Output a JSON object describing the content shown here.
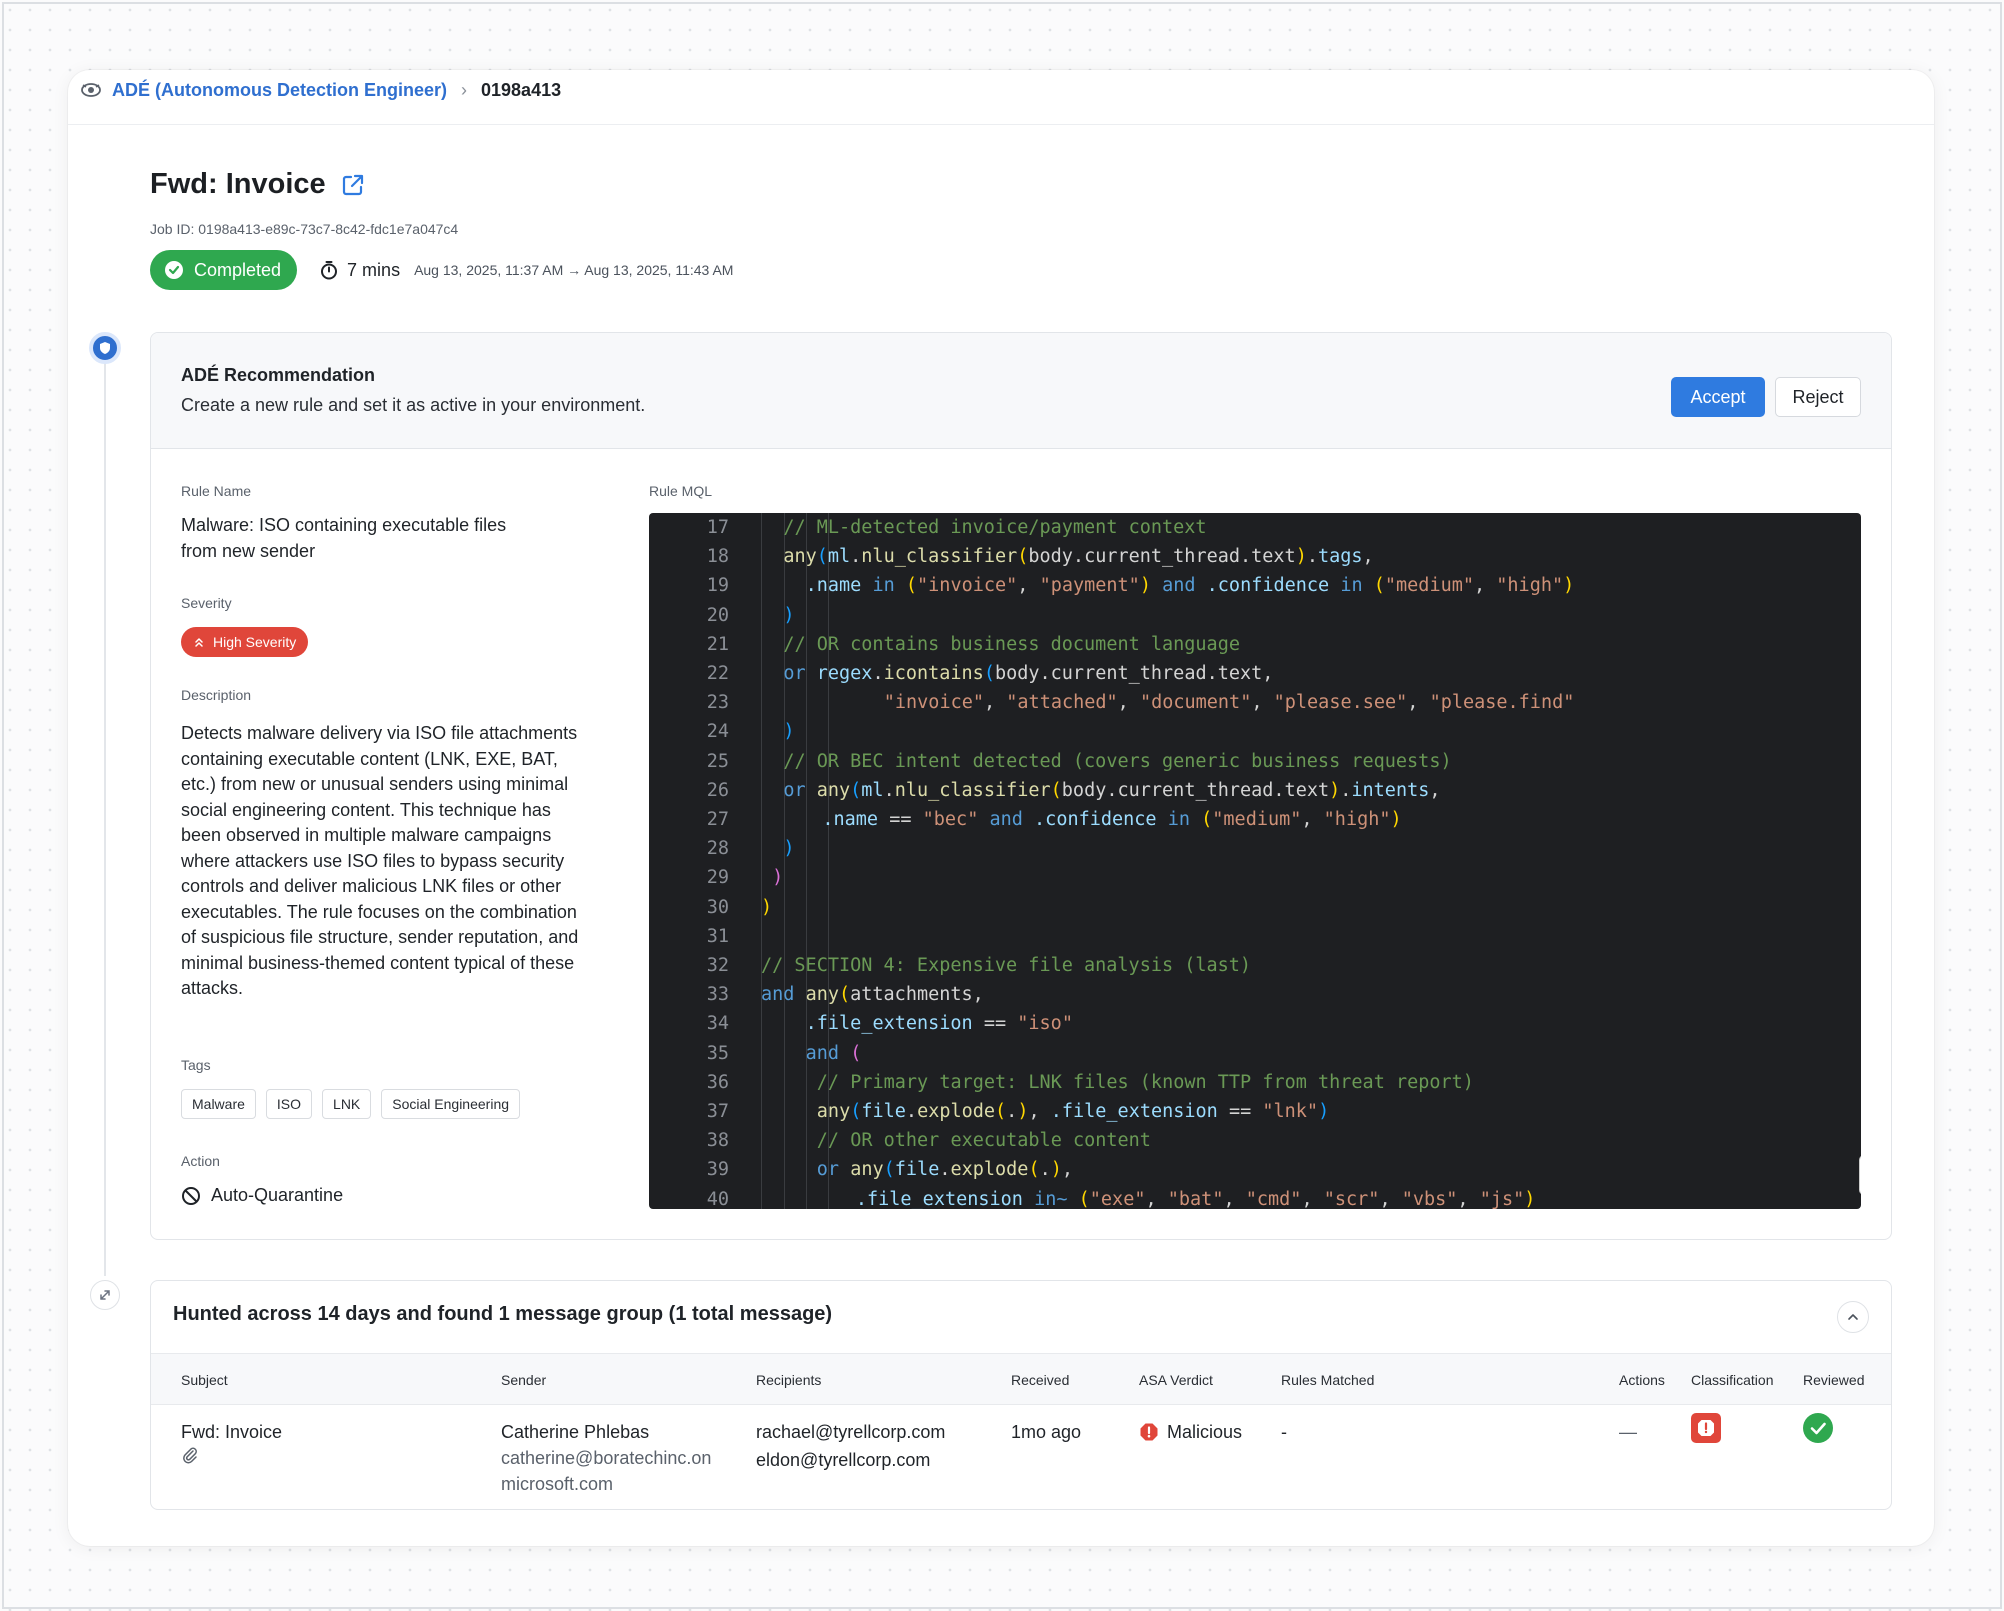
{
  "breadcrumb": {
    "app": "ADÉ (Autonomous Detection Engineer)",
    "current": "0198a413"
  },
  "job": {
    "title": "Fwd: Invoice",
    "job_id": "Job ID: 0198a413-e89c-73c7-8c42-fdc1e7a047c4",
    "status": "Completed",
    "duration": "7 mins",
    "time_range": "Aug 13, 2025, 11:37 AM → Aug 13, 2025, 11:43 AM"
  },
  "recommendation": {
    "title": "ADÉ Recommendation",
    "subtitle": "Create a new rule and set it as active in your environment.",
    "accept_label": "Accept",
    "reject_label": "Reject",
    "rule_name_label": "Rule Name",
    "rule_name": "Malware: ISO containing executable files from new sender",
    "severity_label": "Severity",
    "severity": "High Severity",
    "description_label": "Description",
    "description": "Detects malware delivery via ISO file attachments containing executable content (LNK, EXE, BAT, etc.) from new or unusual senders using minimal social engineering content. This technique has been observed in multiple malware campaigns where attackers use ISO files to bypass security controls and deliver malicious LNK files or other executables. The rule focuses on the combination of suspicious file structure, sender reputation, and minimal business-themed content typical of these attacks.",
    "tags_label": "Tags",
    "tags": [
      "Malware",
      "ISO",
      "LNK",
      "Social Engineering"
    ],
    "action_label": "Action",
    "action": "Auto-Quarantine",
    "mql_label": "Rule MQL"
  },
  "code_lines": [
    {
      "n": "17",
      "indent": 4,
      "tokens": [
        [
          "c-com",
          "// ML-detected invoice/payment context"
        ]
      ]
    },
    {
      "n": "18",
      "indent": 4,
      "tokens": [
        [
          "c-fn",
          "any"
        ],
        [
          "c-par3",
          "("
        ],
        [
          "c-prop",
          "ml"
        ],
        [
          "",
          "."
        ],
        [
          "c-fn",
          "nlu_classifier"
        ],
        [
          "c-par1",
          "("
        ],
        [
          "",
          "body.current_thread.text"
        ],
        [
          "c-par1",
          ")"
        ],
        [
          "",
          "."
        ],
        [
          "c-prop",
          "tags"
        ],
        [
          "",
          ","
        ]
      ]
    },
    {
      "n": "19",
      "indent": 8,
      "tokens": [
        [
          "c-prop",
          ".name"
        ],
        [
          "",
          " "
        ],
        [
          "c-kw",
          "in"
        ],
        [
          "",
          " "
        ],
        [
          "c-par1",
          "("
        ],
        [
          "c-str",
          "\"invoice\""
        ],
        [
          "",
          ", "
        ],
        [
          "c-str",
          "\"payment\""
        ],
        [
          "c-par1",
          ")"
        ],
        [
          "",
          " "
        ],
        [
          "c-kw",
          "and"
        ],
        [
          "",
          " "
        ],
        [
          "c-prop",
          ".confidence"
        ],
        [
          "",
          " "
        ],
        [
          "c-kw",
          "in"
        ],
        [
          "",
          " "
        ],
        [
          "c-par1",
          "("
        ],
        [
          "c-str",
          "\"medium\""
        ],
        [
          "",
          ", "
        ],
        [
          "c-str",
          "\"high\""
        ],
        [
          "c-par1",
          ")"
        ]
      ]
    },
    {
      "n": "20",
      "indent": 4,
      "tokens": [
        [
          "c-par3",
          ")"
        ]
      ]
    },
    {
      "n": "21",
      "indent": 4,
      "tokens": [
        [
          "c-com",
          "// OR contains business document language"
        ]
      ]
    },
    {
      "n": "22",
      "indent": 4,
      "tokens": [
        [
          "c-kw",
          "or"
        ],
        [
          "",
          " "
        ],
        [
          "c-prop",
          "regex"
        ],
        [
          "",
          "."
        ],
        [
          "c-fn",
          "icontains"
        ],
        [
          "c-par3",
          "("
        ],
        [
          "",
          "body.current_thread.text,"
        ]
      ]
    },
    {
      "n": "23",
      "indent": 22,
      "tokens": [
        [
          "c-str",
          "\"invoice\""
        ],
        [
          "",
          ", "
        ],
        [
          "c-str",
          "\"attached\""
        ],
        [
          "",
          ", "
        ],
        [
          "c-str",
          "\"document\""
        ],
        [
          "",
          ", "
        ],
        [
          "c-str",
          "\"please.see\""
        ],
        [
          "",
          ", "
        ],
        [
          "c-str",
          "\"please.find\""
        ]
      ]
    },
    {
      "n": "24",
      "indent": 4,
      "tokens": [
        [
          "c-par3",
          ")"
        ]
      ]
    },
    {
      "n": "25",
      "indent": 4,
      "tokens": [
        [
          "c-com",
          "// OR BEC intent detected (covers generic business requests)"
        ]
      ]
    },
    {
      "n": "26",
      "indent": 4,
      "tokens": [
        [
          "c-kw",
          "or"
        ],
        [
          "",
          " "
        ],
        [
          "c-fn",
          "any"
        ],
        [
          "c-par3",
          "("
        ],
        [
          "c-prop",
          "ml"
        ],
        [
          "",
          "."
        ],
        [
          "c-fn",
          "nlu_classifier"
        ],
        [
          "c-par1",
          "("
        ],
        [
          "",
          "body.current_thread.text"
        ],
        [
          "c-par1",
          ")"
        ],
        [
          "",
          "."
        ],
        [
          "c-prop",
          "intents"
        ],
        [
          "",
          ","
        ]
      ]
    },
    {
      "n": "27",
      "indent": 11,
      "tokens": [
        [
          "c-prop",
          ".name"
        ],
        [
          "",
          " == "
        ],
        [
          "c-str",
          "\"bec\""
        ],
        [
          "",
          " "
        ],
        [
          "c-kw",
          "and"
        ],
        [
          "",
          " "
        ],
        [
          "c-prop",
          ".confidence"
        ],
        [
          "",
          " "
        ],
        [
          "c-kw",
          "in"
        ],
        [
          "",
          " "
        ],
        [
          "c-par1",
          "("
        ],
        [
          "c-str",
          "\"medium\""
        ],
        [
          "",
          ", "
        ],
        [
          "c-str",
          "\"high\""
        ],
        [
          "c-par1",
          ")"
        ]
      ]
    },
    {
      "n": "28",
      "indent": 4,
      "tokens": [
        [
          "c-par3",
          ")"
        ]
      ]
    },
    {
      "n": "29",
      "indent": 2,
      "tokens": [
        [
          "c-par2",
          ")"
        ]
      ]
    },
    {
      "n": "30",
      "indent": 0,
      "tokens": [
        [
          "c-par1",
          ")"
        ]
      ]
    },
    {
      "n": "31",
      "indent": 0,
      "tokens": []
    },
    {
      "n": "32",
      "indent": 0,
      "tokens": [
        [
          "c-com",
          "// SECTION 4: Expensive file analysis (last)"
        ]
      ]
    },
    {
      "n": "33",
      "indent": 0,
      "tokens": [
        [
          "c-kw",
          "and"
        ],
        [
          "",
          " "
        ],
        [
          "c-fn",
          "any"
        ],
        [
          "c-par1",
          "("
        ],
        [
          "",
          "attachments,"
        ]
      ]
    },
    {
      "n": "34",
      "indent": 8,
      "tokens": [
        [
          "c-prop",
          ".file_extension"
        ],
        [
          "",
          " == "
        ],
        [
          "c-str",
          "\"iso\""
        ]
      ]
    },
    {
      "n": "35",
      "indent": 8,
      "tokens": [
        [
          "c-kw",
          "and"
        ],
        [
          "",
          " "
        ],
        [
          "c-par2",
          "("
        ]
      ]
    },
    {
      "n": "36",
      "indent": 10,
      "tokens": [
        [
          "c-com",
          "// Primary target: LNK files (known TTP from threat report)"
        ]
      ]
    },
    {
      "n": "37",
      "indent": 10,
      "tokens": [
        [
          "c-fn",
          "any"
        ],
        [
          "c-par3",
          "("
        ],
        [
          "c-prop",
          "file"
        ],
        [
          "",
          "."
        ],
        [
          "c-fn",
          "explode"
        ],
        [
          "c-par1",
          "("
        ],
        [
          "",
          "."
        ],
        [
          "c-par1",
          ")"
        ],
        [
          "",
          ", "
        ],
        [
          "c-prop",
          ".file_extension"
        ],
        [
          "",
          " == "
        ],
        [
          "c-str",
          "\"lnk\""
        ],
        [
          "c-par3",
          ")"
        ]
      ]
    },
    {
      "n": "38",
      "indent": 10,
      "tokens": [
        [
          "c-com",
          "// OR other executable content"
        ]
      ]
    },
    {
      "n": "39",
      "indent": 10,
      "tokens": [
        [
          "c-kw",
          "or"
        ],
        [
          "",
          " "
        ],
        [
          "c-fn",
          "any"
        ],
        [
          "c-par3",
          "("
        ],
        [
          "c-prop",
          "file"
        ],
        [
          "",
          "."
        ],
        [
          "c-fn",
          "explode"
        ],
        [
          "c-par1",
          "("
        ],
        [
          "",
          "."
        ],
        [
          "c-par1",
          ")"
        ],
        [
          "",
          ","
        ]
      ]
    },
    {
      "n": "40",
      "indent": 17,
      "tokens": [
        [
          "c-prop",
          ".file_extension"
        ],
        [
          "",
          " "
        ],
        [
          "c-kw",
          "in~"
        ],
        [
          "",
          " "
        ],
        [
          "c-par1",
          "("
        ],
        [
          "c-str",
          "\"exe\""
        ],
        [
          "",
          ", "
        ],
        [
          "c-str",
          "\"bat\""
        ],
        [
          "",
          ", "
        ],
        [
          "c-str",
          "\"cmd\""
        ],
        [
          "",
          ", "
        ],
        [
          "c-str",
          "\"scr\""
        ],
        [
          "",
          ", "
        ],
        [
          "c-str",
          "\"vbs\""
        ],
        [
          "",
          ", "
        ],
        [
          "c-str",
          "\"js\""
        ],
        [
          "c-par1",
          ")"
        ]
      ]
    }
  ],
  "hunt": {
    "title": "Hunted across 14 days and found 1 message group (1 total message)",
    "columns": {
      "subject": "Subject",
      "sender": "Sender",
      "recipients": "Recipients",
      "received": "Received",
      "verdict": "ASA Verdict",
      "rules": "Rules Matched",
      "actions": "Actions",
      "classification": "Classification",
      "reviewed": "Reviewed"
    },
    "row": {
      "subject": "Fwd: Invoice",
      "sender_name": "Catherine Phlebas",
      "sender_email_1": "catherine@boratechinc.on",
      "sender_email_2": "microsoft.com",
      "recipient_1": "rachael@tyrellcorp.com",
      "recipient_2": "eldon@tyrellcorp.com",
      "received": "1mo ago",
      "verdict": "Malicious",
      "rules": "-",
      "actions": "—"
    }
  },
  "colors": {
    "accent": "#2f7be0",
    "success": "#2fa84f",
    "danger": "#e0463a",
    "code_bg": "#1e1f22"
  }
}
